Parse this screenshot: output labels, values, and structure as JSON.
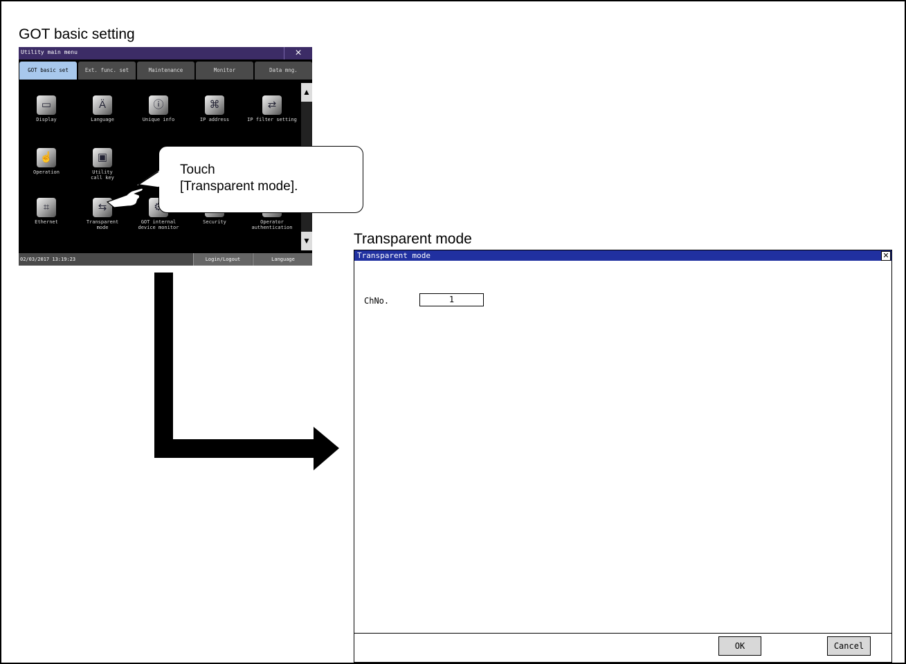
{
  "left_heading": "GOT basic setting",
  "right_heading": "Transparent mode",
  "got": {
    "title": "Utility main menu",
    "close_symbol": "×",
    "tabs": [
      "GOT basic set",
      "Ext. func. set",
      "Maintenance",
      "Monitor",
      "Data mng."
    ],
    "items": [
      {
        "label": "Display",
        "icon": "display-icon"
      },
      {
        "label": "Language",
        "icon": "language-icon"
      },
      {
        "label": "Unique info",
        "icon": "unique-info-icon"
      },
      {
        "label": "IP address",
        "icon": "ip-address-icon"
      },
      {
        "label": "IP filter setting",
        "icon": "ip-filter-icon"
      },
      {
        "label": "Operation",
        "icon": "operation-icon"
      },
      {
        "label": "Utility\ncall key",
        "icon": "utility-call-key-icon"
      },
      {
        "label": "Ethernet",
        "icon": "ethernet-icon"
      },
      {
        "label": "Transparent\nmode",
        "icon": "transparent-mode-icon"
      },
      {
        "label": "GOT internal\ndevice monitor",
        "icon": "device-monitor-icon"
      },
      {
        "label": "Security",
        "icon": "security-icon"
      },
      {
        "label": "Operator\nauthentication",
        "icon": "operator-auth-icon"
      }
    ],
    "status": {
      "datetime": "02/03/2017 13:19:23",
      "login": "Login/Logout",
      "language": "Language"
    },
    "scroll_up": "▲",
    "scroll_down": "▼"
  },
  "callout": {
    "line1": "Touch",
    "line2": "[Transparent mode]."
  },
  "window": {
    "title": "Transparent mode",
    "close_symbol": "✕",
    "ch_label": "ChNo.",
    "ch_value": "1",
    "ok_label": "OK",
    "cancel_label": "Cancel"
  }
}
